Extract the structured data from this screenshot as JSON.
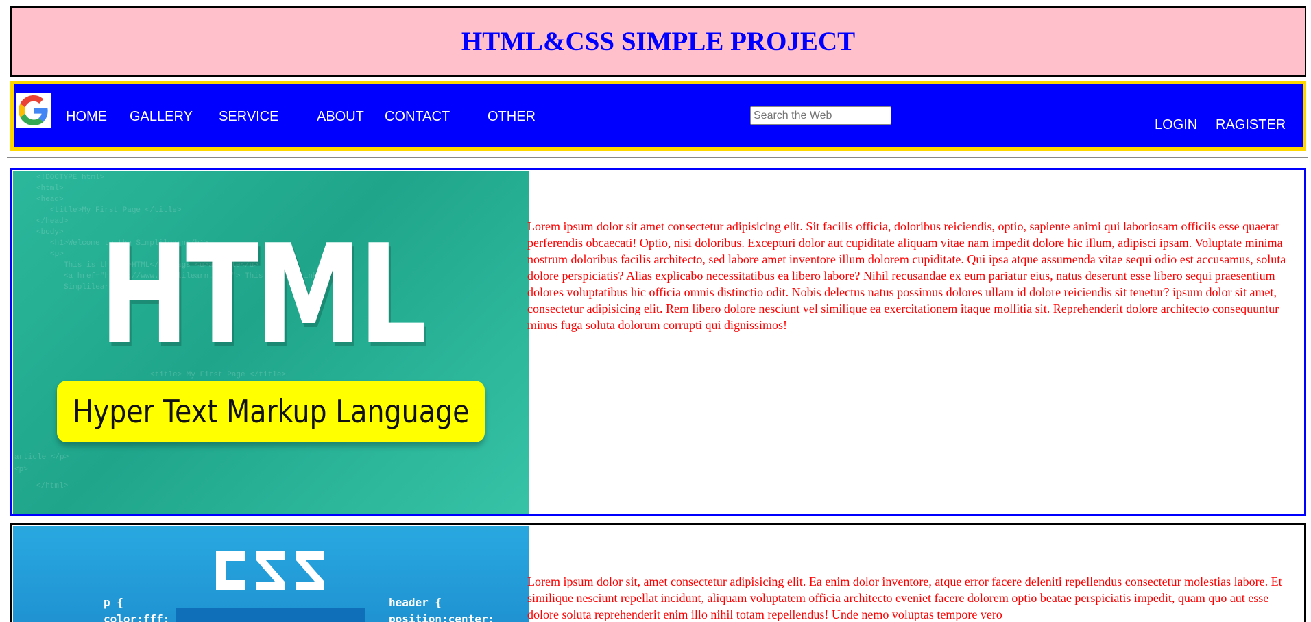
{
  "header": {
    "title": "HTML&CSS SIMPLE PROJECT"
  },
  "nav": {
    "logo_icon": "google-logo-icon",
    "links": [
      "HOME",
      "GALLERY",
      "SERVICE",
      "ABOUT",
      "CONTACT",
      "OTHER"
    ],
    "search_placeholder": "Search the Web",
    "search_value": "",
    "login_label": "LOGIN",
    "register_label": "RAGISTER"
  },
  "colors": {
    "header_bg": "#ffc0cb",
    "header_text": "#0000ff",
    "nav_bg": "#0000ff",
    "nav_border": "#ffd700",
    "body_text": "#ff0000",
    "section1_border": "#0000ff",
    "section2_border": "#000000"
  },
  "sections": [
    {
      "image": {
        "big_text": "HTML",
        "subtitle": "Hyper Text Markup Language",
        "code_lines": [
          "<!DOCTYPE html>",
          "<html>",
          "<head>",
          "<title>My First Page </title>",
          "</head>",
          "<body>",
          "<h1>Welcome to the Simplilearn</h1>",
          "<p>",
          "This is the <b>HTML</b> tags <u>article</u>",
          "<a href=\"https://www.simplilearn.com/\"> This is the link to",
          "Simplilearn website</a>",
          "<title> My First Page </title>",
          "article </p>",
          "<p>",
          "</html>"
        ]
      },
      "text": "Lorem ipsum dolor sit amet consectetur adipisicing elit. Sit facilis officia, doloribus reiciendis, optio, sapiente animi qui laboriosam officiis esse quaerat perferendis obcaecati! Optio, nisi doloribus. Excepturi dolor aut cupiditate aliquam vitae nam impedit dolore hic illum, adipisci ipsam. Voluptate minima nostrum doloribus facilis architecto, sed labore amet inventore illum dolorem cupiditate. Qui ipsa atque assumenda vitae sequi odio est accusamus, soluta dolore perspiciatis? Alias explicabo necessitatibus ea libero labore? Nihil recusandae ex eum pariatur eius, natus deserunt esse libero sequi praesentium dolores voluptatibus hic officia omnis distinctio odit. Nobis delectus natus possimus dolores ullam id dolore reiciendis sit tenetur? ipsum dolor sit amet, consectetur adipisicing elit. Rem libero dolore nesciunt vel similique ea exercitationem itaque mollitia sit. Reprehenderit dolore architecto consequuntur minus fuga soluta dolorum corrupti qui dignissimos!"
    },
    {
      "image": {
        "left_code": "p {\ncolor:fff;",
        "right_code": "header {\nposition:center;"
      },
      "text": "Lorem ipsum dolor sit, amet consectetur adipisicing elit. Ea enim dolor inventore, atque error facere deleniti repellendus consectetur molestias labore. Et similique nesciunt repellat incidunt, aliquam voluptatem officia architecto eveniet facere dolorem optio beatae perspiciatis impedit, quam quo aut esse dolore soluta reprehenderit enim illo nihil totam repellendus! Unde nemo voluptas tempore vero"
    }
  ]
}
